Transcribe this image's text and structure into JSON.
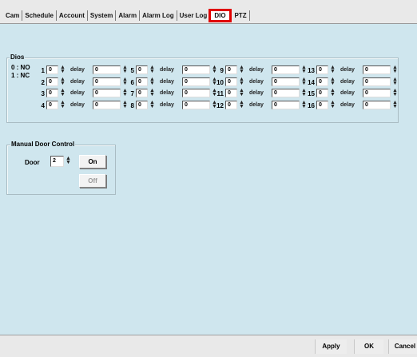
{
  "tabs": [
    {
      "label": "Cam",
      "active": false
    },
    {
      "label": "Schedule",
      "active": false
    },
    {
      "label": "Account",
      "active": false
    },
    {
      "label": "System",
      "active": false
    },
    {
      "label": "Alarm",
      "active": false
    },
    {
      "label": "Alarm Log",
      "active": false
    },
    {
      "label": "User Log",
      "active": false
    },
    {
      "label": "DIO",
      "active": true
    },
    {
      "label": "PTZ",
      "active": false
    }
  ],
  "dios": {
    "title": "Dios",
    "legend": [
      "0 : NO",
      "1 : NC"
    ],
    "delay_label": "delay",
    "items": [
      {
        "num": "1",
        "value": "0",
        "delay": "0"
      },
      {
        "num": "2",
        "value": "0",
        "delay": "0"
      },
      {
        "num": "3",
        "value": "0",
        "delay": "0"
      },
      {
        "num": "4",
        "value": "0",
        "delay": "0"
      },
      {
        "num": "5",
        "value": "0",
        "delay": "0"
      },
      {
        "num": "6",
        "value": "0",
        "delay": "0"
      },
      {
        "num": "7",
        "value": "0",
        "delay": "0"
      },
      {
        "num": "8",
        "value": "0",
        "delay": "0"
      },
      {
        "num": "9",
        "value": "0",
        "delay": "0"
      },
      {
        "num": "10",
        "value": "0",
        "delay": "0"
      },
      {
        "num": "11",
        "value": "0",
        "delay": "0"
      },
      {
        "num": "12",
        "value": "0",
        "delay": "0"
      },
      {
        "num": "13",
        "value": "0",
        "delay": "0"
      },
      {
        "num": "14",
        "value": "0",
        "delay": "0"
      },
      {
        "num": "15",
        "value": "0",
        "delay": "0"
      },
      {
        "num": "16",
        "value": "0",
        "delay": "0"
      }
    ]
  },
  "manual": {
    "title": "Manual Door Control",
    "door_label": "Door",
    "door_value": "2",
    "on_label": "On",
    "off_label": "Off"
  },
  "bottom": {
    "apply": "Apply",
    "ok": "OK",
    "cancel": "Cancel"
  },
  "colors": {
    "background": "#cfe6ee",
    "active_tab_highlight": "#e00000"
  }
}
